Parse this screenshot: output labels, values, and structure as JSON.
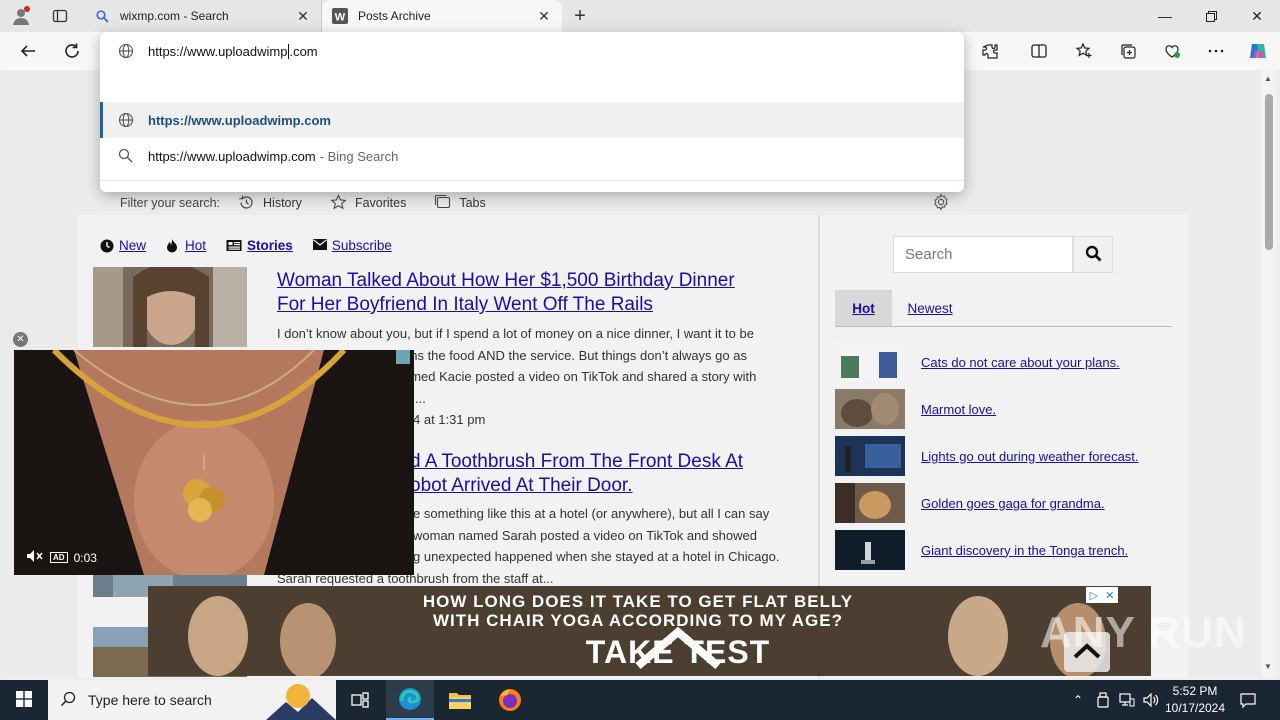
{
  "browser": {
    "tabs": [
      {
        "title": "wixmp.com - Search"
      },
      {
        "title": "Posts Archive"
      }
    ],
    "omnibox": {
      "typed_text": "https://www.uploadwimp",
      "autocomplete_suffix": ".com",
      "suggestions": [
        {
          "text": "https://www.uploadwimp.com"
        },
        {
          "text": "https://www.uploadwimp.com",
          "source": "- Bing Search"
        }
      ],
      "filter_label": "Filter your search:",
      "filters": [
        "History",
        "Favorites",
        "Tabs"
      ]
    }
  },
  "page": {
    "nav": [
      {
        "label": "New",
        "icon": "clock-icon"
      },
      {
        "label": "Hot",
        "icon": "fire-icon"
      },
      {
        "label": "Stories",
        "icon": "newspaper-icon",
        "active": true
      },
      {
        "label": "Subscribe",
        "icon": "envelope-icon"
      }
    ],
    "posts": [
      {
        "title_line1": "Woman Talked About How Her $1,500 Birthday Dinner",
        "title_line2": "For Her Boyfriend In Italy Went Off The Rails",
        "excerpt_lines": [
          "I don’t know about you, but if I spend a lot of money on a nice dinner, I want it to be",
          "ans the food AND the service. But things don’t always go as",
          "amed Kacie posted a video on TikTok and shared a story with",
          "..."
        ],
        "date": "4 at 1:31 pm"
      },
      {
        "title_line1": "d A Toothbrush From The Front Desk At",
        "title_line2": "obot Arrived At Their Door.",
        "excerpt_lines": [
          "e something like this at a hotel (or anywhere), but all I can say",
          "woman named Sarah posted a video on TikTok and showed",
          "g unexpected happened when she stayed at a hotel in Chicago.",
          "Sarah requested a toothbrush from the staff at..."
        ]
      }
    ],
    "sidebar": {
      "search_placeholder": "Search",
      "tabs": [
        "Hot",
        "Newest"
      ],
      "items": [
        {
          "title": "Cats do not care about your plans."
        },
        {
          "title": "Marmot love."
        },
        {
          "title": "Lights go out during weather forecast."
        },
        {
          "title": "Golden goes gaga for grandma."
        },
        {
          "title": "Giant discovery in the Tonga trench."
        }
      ]
    },
    "video": {
      "time": "0:03",
      "ad_label": "AD"
    },
    "banner": {
      "line1": "HOW LONG DOES IT TAKE TO GET FLAT BELLY",
      "line2": "WITH CHAIR YOGA ACCORDING TO MY AGE?",
      "cta": "TAKE TEST"
    },
    "watermark": "ANY RUN"
  },
  "taskbar": {
    "search_placeholder": "Type here to search",
    "time": "5:52 PM",
    "date": "10/17/2024"
  },
  "colors": {
    "link": "#1a0dab",
    "suggestion_accent": "#1f5fa8",
    "taskbar": "#1b2633"
  }
}
